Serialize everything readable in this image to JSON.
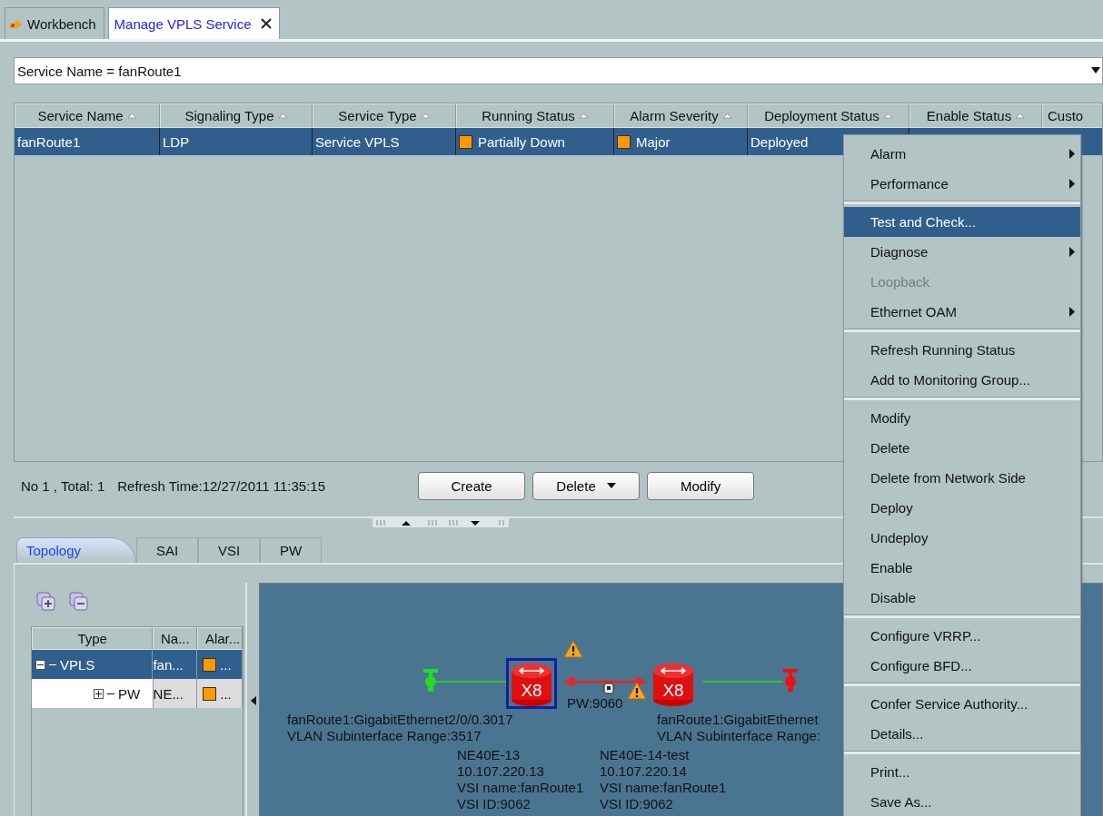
{
  "tabs": [
    {
      "label": "Workbench",
      "selected": false,
      "closable": false
    },
    {
      "label": "Manage VPLS Service",
      "selected": true,
      "closable": true
    }
  ],
  "filter": {
    "value": "Service Name = fanRoute1"
  },
  "table": {
    "columns": [
      {
        "label": "Service Name",
        "sort": true
      },
      {
        "label": "Signaling Type",
        "sort": true
      },
      {
        "label": "Service Type",
        "sort": true
      },
      {
        "label": "Running Status",
        "sort": true
      },
      {
        "label": "Alarm Severity",
        "sort": true
      },
      {
        "label": "Deployment Status",
        "sort": true
      },
      {
        "label": "Enable Status",
        "sort": true
      },
      {
        "label": "Custo",
        "sort": false
      }
    ],
    "rows": [
      {
        "selected": true,
        "cells": [
          {
            "text": "fanRoute1"
          },
          {
            "text": "LDP"
          },
          {
            "text": "Service VPLS"
          },
          {
            "text": "Partially Down",
            "color": "#ff9900"
          },
          {
            "text": "Major",
            "color": "#ff9900"
          },
          {
            "text": "Deployed"
          }
        ]
      }
    ]
  },
  "status": {
    "count": "No 1 , Total: 1",
    "refresh": "Refresh Time:12/27/2011 11:35:15"
  },
  "buttons": [
    {
      "label": "Create",
      "dropdown": false
    },
    {
      "label": "Delete",
      "dropdown": true
    },
    {
      "label": "Modify",
      "dropdown": false
    }
  ],
  "bottom_tabs": [
    {
      "label": "Topology",
      "selected": true
    },
    {
      "label": "SAI",
      "selected": false
    },
    {
      "label": "VSI",
      "selected": false
    },
    {
      "label": "PW",
      "selected": false
    }
  ],
  "tree": {
    "columns": [
      "Type",
      "Na...",
      "Alar..."
    ],
    "rows": [
      {
        "type": "VPLS",
        "name": "fan...",
        "alarm": "...",
        "color": "#ff9900",
        "selected": true,
        "expanded": true,
        "children": [
          {
            "type": "PW",
            "name": "NE...",
            "alarm": "...",
            "color": "#ff9900",
            "selected": false,
            "expanded": false
          }
        ]
      }
    ]
  },
  "topology": {
    "endpoints": [
      {
        "color": "#22dd22"
      },
      {
        "color": "#ee1111"
      }
    ],
    "nodes": [
      {
        "label": "X8",
        "selected": true,
        "alarm": true,
        "port": [
          "fanRoute1:GigabitEthernet2/0/0.3017",
          "VLAN Subinterface Range:3517"
        ],
        "info": [
          "NE40E-13",
          "10.107.220.13",
          "VSI name:fanRoute1",
          "VSI ID:9062"
        ]
      },
      {
        "label": "X8",
        "selected": false,
        "alarm": false,
        "port": [
          "fanRoute1:GigabitEthernet",
          "VLAN Subinterface Range:"
        ],
        "info": [
          "NE40E-14-test",
          "10.107.220.14",
          "VSI name:fanRoute1",
          "VSI ID:9062"
        ]
      }
    ],
    "pw": {
      "label": "PW:9060",
      "alarm": true
    }
  },
  "menu": [
    {
      "kind": "item",
      "label": "Alarm",
      "submenu": true,
      "disabled": false,
      "selected": false
    },
    {
      "kind": "item",
      "label": "Performance",
      "submenu": true,
      "disabled": false,
      "selected": false
    },
    {
      "kind": "separator"
    },
    {
      "kind": "item",
      "label": "Test and Check...",
      "submenu": false,
      "disabled": false,
      "selected": true
    },
    {
      "kind": "item",
      "label": "Diagnose",
      "submenu": true,
      "disabled": false,
      "selected": false
    },
    {
      "kind": "item",
      "label": "Loopback",
      "submenu": false,
      "disabled": true,
      "selected": false
    },
    {
      "kind": "item",
      "label": "Ethernet OAM",
      "submenu": true,
      "disabled": false,
      "selected": false
    },
    {
      "kind": "separator"
    },
    {
      "kind": "item",
      "label": "Refresh Running Status",
      "submenu": false,
      "disabled": false,
      "selected": false
    },
    {
      "kind": "item",
      "label": "Add to Monitoring Group...",
      "submenu": false,
      "disabled": false,
      "selected": false
    },
    {
      "kind": "separator"
    },
    {
      "kind": "item",
      "label": "Modify",
      "submenu": false,
      "disabled": false,
      "selected": false
    },
    {
      "kind": "item",
      "label": "Delete",
      "submenu": false,
      "disabled": false,
      "selected": false
    },
    {
      "kind": "item",
      "label": "Delete from Network Side",
      "submenu": false,
      "disabled": false,
      "selected": false
    },
    {
      "kind": "item",
      "label": "Deploy",
      "submenu": false,
      "disabled": false,
      "selected": false
    },
    {
      "kind": "item",
      "label": "Undeploy",
      "submenu": false,
      "disabled": false,
      "selected": false
    },
    {
      "kind": "item",
      "label": "Enable",
      "submenu": false,
      "disabled": false,
      "selected": false
    },
    {
      "kind": "item",
      "label": "Disable",
      "submenu": false,
      "disabled": false,
      "selected": false
    },
    {
      "kind": "separator"
    },
    {
      "kind": "item",
      "label": "Configure VRRP...",
      "submenu": false,
      "disabled": false,
      "selected": false
    },
    {
      "kind": "item",
      "label": "Configure BFD...",
      "submenu": false,
      "disabled": false,
      "selected": false
    },
    {
      "kind": "separator"
    },
    {
      "kind": "item",
      "label": "Confer Service Authority...",
      "submenu": false,
      "disabled": false,
      "selected": false
    },
    {
      "kind": "item",
      "label": "Details...",
      "submenu": false,
      "disabled": false,
      "selected": false
    },
    {
      "kind": "separator"
    },
    {
      "kind": "item",
      "label": "Print...",
      "submenu": false,
      "disabled": false,
      "selected": false
    },
    {
      "kind": "item",
      "label": "Save As...",
      "submenu": false,
      "disabled": false,
      "selected": false
    }
  ]
}
